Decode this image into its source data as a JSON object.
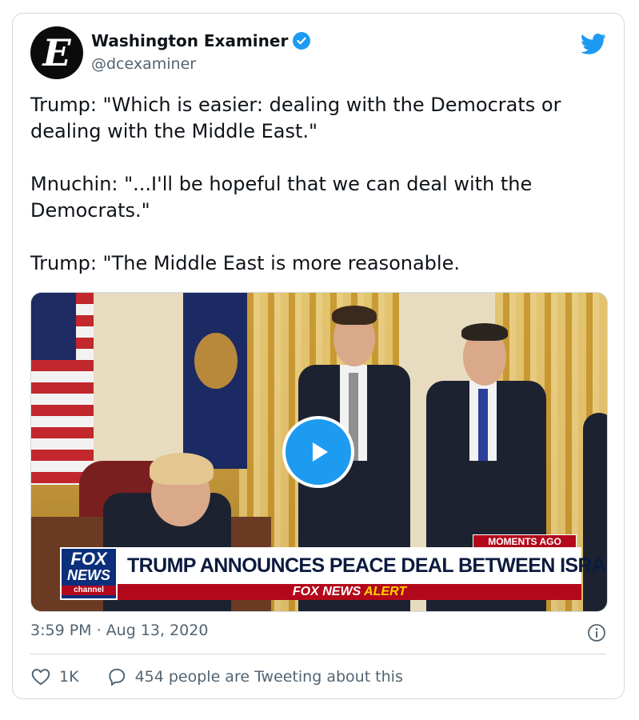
{
  "tweet": {
    "author": {
      "display_name": "Washington Examiner",
      "handle": "@dcexaminer",
      "avatar_glyph": "E",
      "verified": true
    },
    "text_lines": [
      "Trump: \"Which is easier: dealing with the Democrats or dealing with the Middle East.\"",
      "Mnuchin: \"...I'll be hopeful that we can deal with the Democrats.\"",
      "Trump: \"The Middle East is more reasonable."
    ],
    "media": {
      "type": "video",
      "overlay": {
        "moments_label": "MOMENTS AGO",
        "logo_line1": "FOX",
        "logo_line2": "NEWS",
        "logo_line3": "channel",
        "headline": "TRUMP ANNOUNCES PEACE DEAL BETWEEN ISRAEL & UAE",
        "alert_brand": "FOX NEWS ",
        "alert_word": "ALERT"
      }
    },
    "timestamp": "3:59 PM · Aug 13, 2020",
    "actions": {
      "likes": "1K",
      "conversation": "454 people are Tweeting about this"
    }
  },
  "colors": {
    "accent": "#1d9bf0",
    "text": "#0f1419",
    "secondary_text": "#536471",
    "fox_red": "#b3081b",
    "fox_blue": "#0b2f7a"
  },
  "icons": [
    "twitter-bird-icon",
    "verified-badge-icon",
    "play-icon",
    "info-icon",
    "heart-icon",
    "speech-bubble-icon"
  ]
}
